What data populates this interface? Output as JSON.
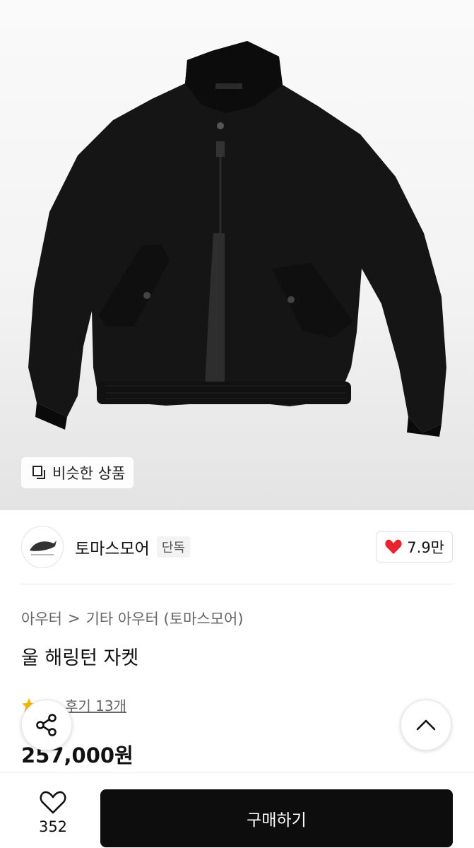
{
  "product_image": {
    "similar_button_label": "비슷한 상품",
    "colors": {
      "background": "#f3f3f3",
      "jacket": "#141414"
    }
  },
  "seller": {
    "name": "토마스모어",
    "badge": "단독",
    "likes": "7.9만",
    "avatar_icon": "jumping-whale-logo-icon"
  },
  "product": {
    "breadcrumb": [
      "아우터",
      "기타 아우터 (토마스모어)"
    ],
    "breadcrumb_separator": ">",
    "title": "울 해링턴 자켓",
    "review_link": "후기 13개",
    "price": "257,000원"
  },
  "actions": {
    "share_icon": "share-icon",
    "scroll_top_icon": "chevron-up-icon"
  },
  "bottom_bar": {
    "wish_count": "352",
    "buy_label": "구매하기"
  },
  "accent_colors": {
    "heart": "#e8242f",
    "star": "#f5b400",
    "buy_button": "#0d0d0d"
  }
}
